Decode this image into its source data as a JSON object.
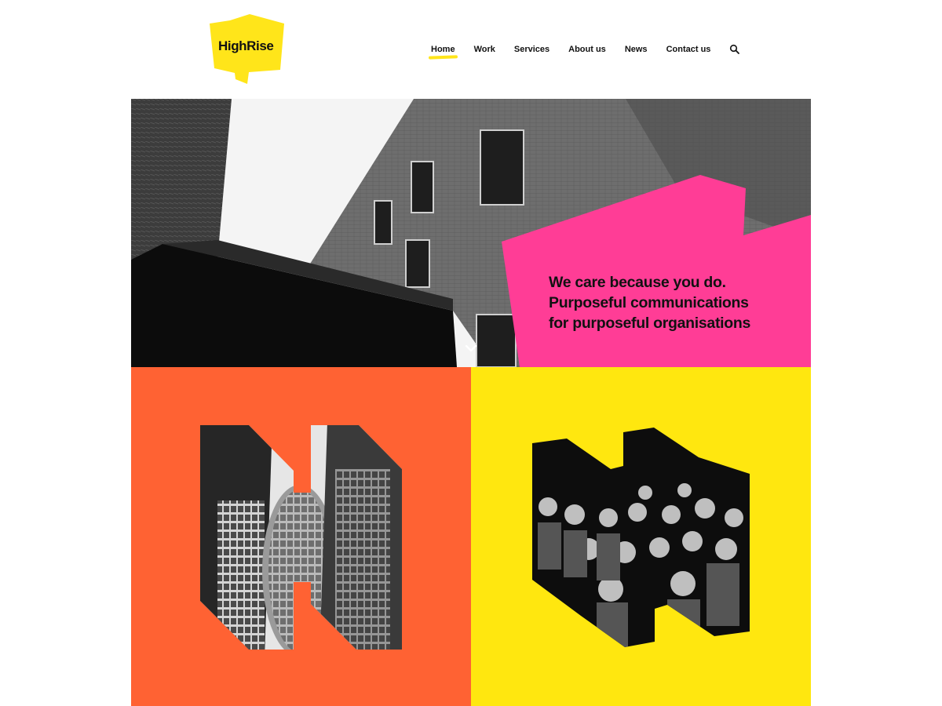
{
  "header": {
    "logo_text": "HighRise",
    "nav": [
      {
        "label": "Home",
        "active": true
      },
      {
        "label": "Work",
        "active": false
      },
      {
        "label": "Services",
        "active": false
      },
      {
        "label": "About us",
        "active": false
      },
      {
        "label": "News",
        "active": false
      },
      {
        "label": "Contact us",
        "active": false
      }
    ],
    "search_icon": "search-icon"
  },
  "hero": {
    "lines": [
      "We care because you do.",
      "Purposeful communications",
      "for purposeful organisations"
    ],
    "scroll_icon": "chevron-down-icon"
  },
  "tiles": [
    {
      "color": "#ff6233",
      "content": "city-buildings-photo"
    },
    {
      "color": "#ffe70f",
      "content": "audience-photo"
    }
  ],
  "colors": {
    "brand_yellow": "#ffe51a",
    "pink": "#ff3d96",
    "orange": "#ff6233",
    "yellow_tile": "#ffe70f"
  }
}
